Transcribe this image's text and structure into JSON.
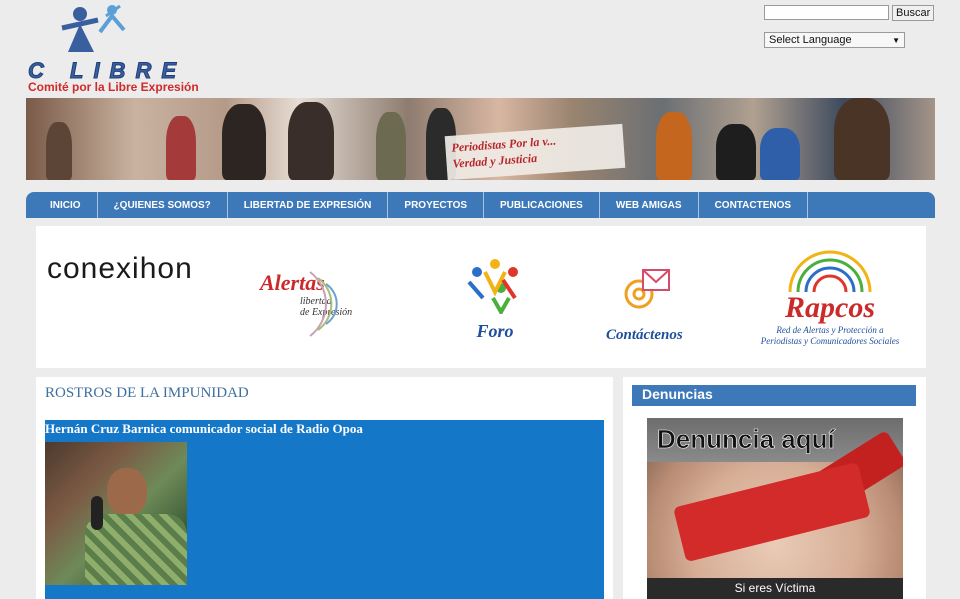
{
  "logo": {
    "wordmark": "C LIBRE",
    "tagline": "Comité por la Libre Expresión"
  },
  "search": {
    "value": "",
    "placeholder": "",
    "button_label": "Buscar"
  },
  "language": {
    "selected": "Select Language"
  },
  "banner": {
    "sign_text_1": "Periodistas Por la v...",
    "sign_text_2": "Verdad y Justicia"
  },
  "nav": {
    "items": [
      "INICIO",
      "¿QUIENES SOMOS?",
      "LIBERTAD DE EXPRESIÓN",
      "PROYECTOS",
      "PUBLICACIONES",
      "WEB AMIGAS",
      "CONTACTENOS"
    ]
  },
  "partners": {
    "conexion": "conexihon",
    "alertas_title": "Alertas",
    "alertas_sub_1": "libertad",
    "alertas_sub_2": "de Expresión",
    "foro": "Foro",
    "contact": "Contáctenos",
    "rapcos_title": "Rapcos",
    "rapcos_sub_1": "Red de Alertas y Protección a",
    "rapcos_sub_2": "Periodistas y Comunicadores Sociales"
  },
  "main": {
    "section_title": "ROSTROS DE LA IMPUNIDAD",
    "headline": "Hernán Cruz Barnica comunicador social de Radio Opoa"
  },
  "sidebar": {
    "header": "Denuncias",
    "cta": "Denuncia aquí",
    "bottom_text": "Si eres Víctima"
  },
  "colors": {
    "nav_blue": "#3d78b8",
    "panel_blue": "#1577c7",
    "accent_red": "#cc2a2a"
  }
}
